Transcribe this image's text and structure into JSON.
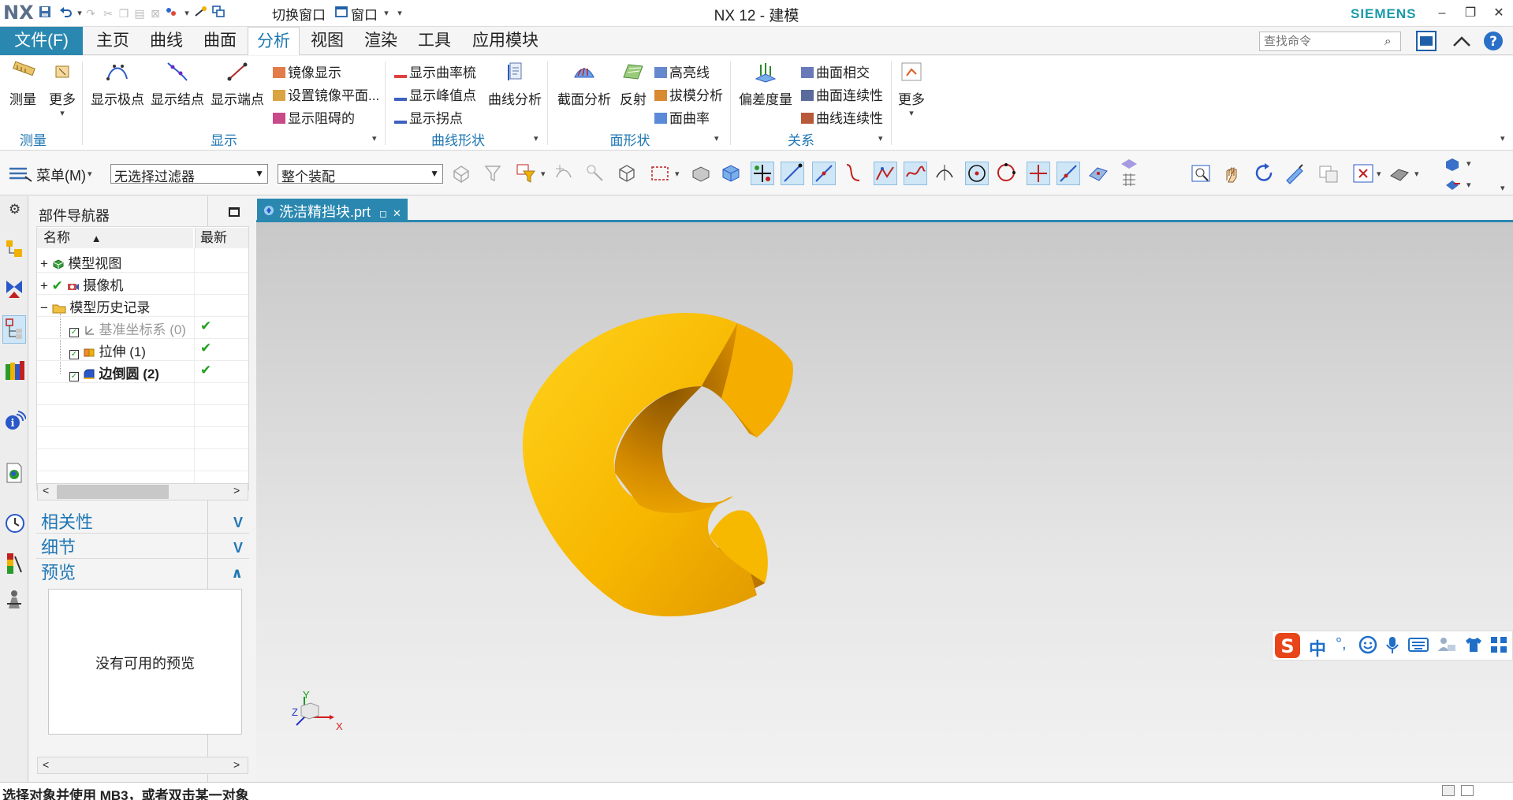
{
  "app": {
    "logo": "NX",
    "title": "NX 12 - 建模",
    "brand": "SIEMENS",
    "quick_access": {
      "switch_window": "切换窗口",
      "window": "窗口"
    }
  },
  "tabs": {
    "file": "文件(F)",
    "items": [
      "主页",
      "曲线",
      "曲面",
      "分析",
      "视图",
      "渲染",
      "工具",
      "应用模块"
    ],
    "active": "分析"
  },
  "search": {
    "placeholder": "查找命令"
  },
  "ribbon": {
    "measure": {
      "measure": "测量",
      "more": "更多",
      "group": "测量"
    },
    "display": {
      "poles": "显示极点",
      "knots": "显示结点",
      "endpoints": "显示端点",
      "mirror_display": "镜像显示",
      "set_mirror_plane": "设置镜像平面...",
      "show_blocking": "显示阻碍的",
      "group": "显示"
    },
    "curve_shape": {
      "curvature_comb": "显示曲率梳",
      "peak": "显示峰值点",
      "inflection": "显示拐点",
      "curve_analysis": "曲线分析",
      "group": "曲线形状"
    },
    "face_shape": {
      "section_analysis": "截面分析",
      "reflection": "反射",
      "highlight_lines": "高亮线",
      "draft_analysis": "拔模分析",
      "face_curvature": "面曲率",
      "group": "面形状"
    },
    "relation": {
      "deviation": "偏差度量",
      "face_intersect": "曲面相交",
      "face_continuity": "曲面连续性",
      "curve_continuity": "曲线连续性",
      "group": "关系"
    },
    "more": {
      "more": "更多"
    }
  },
  "selection_bar": {
    "menu": "菜单(M)",
    "filter": "无选择过滤器",
    "scope": "整个装配"
  },
  "navigator": {
    "title": "部件导航器",
    "col_name": "名称",
    "col_latest": "最新",
    "nodes": [
      {
        "label": "模型视图"
      },
      {
        "label": "摄像机"
      },
      {
        "label": "模型历史记录"
      },
      {
        "label": "基准坐标系 (0)"
      },
      {
        "label": "拉伸 (1)"
      },
      {
        "label": "边倒圆 (2)"
      }
    ],
    "panels": {
      "dependencies": "相关性",
      "details": "细节",
      "preview": "预览"
    },
    "preview_empty": "没有可用的预览"
  },
  "document": {
    "tab": "洗洁精挡块.prt"
  },
  "triad": {
    "x": "X",
    "y": "Y",
    "z": "Z"
  },
  "ime": {
    "mode": "中"
  },
  "status": {
    "message": "选择对象并使用 MB3，或者双击某一对象"
  },
  "colors": {
    "accent": "#2a88b0",
    "part": "#f5b400",
    "group_label": "#1f77b4"
  }
}
